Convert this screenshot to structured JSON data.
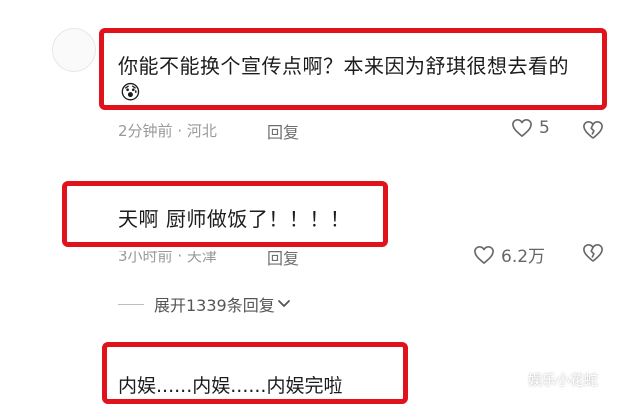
{
  "comments": [
    {
      "text_line1": "你能不能换个宣传点啊？本来因为舒琪很想去看的",
      "text_line2_emoji": "😰",
      "time": "2分钟前",
      "location": "河北",
      "reply_label": "回复",
      "likes": "5"
    },
    {
      "text": "天啊 厨师做饭了！！！！",
      "time": "3小时前",
      "location": "天津",
      "reply_label": "回复",
      "likes": "6.2万"
    },
    {
      "text": "内娱......内娱......内娱完啦"
    }
  ],
  "expand_replies": {
    "label": "展开1339条回复",
    "icon": "chevron-down-icon"
  },
  "watermark": {
    "text": "娱乐小花蛇",
    "icon": "watermark-logo-icon"
  },
  "colors": {
    "highlight": "#e0131c"
  }
}
